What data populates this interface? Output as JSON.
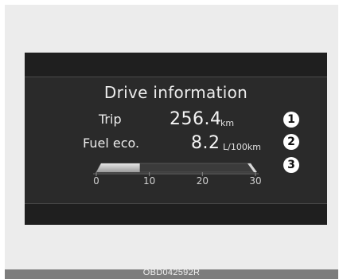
{
  "screen": {
    "title": "Drive information",
    "trip": {
      "label": "Trip",
      "value": "256.4",
      "unit": "km",
      "marker": "1"
    },
    "fuel_economy": {
      "label": "Fuel eco.",
      "value": "8.2",
      "unit": "L/100km",
      "marker": "2"
    },
    "gauge": {
      "marker": "3",
      "scale": {
        "min": 0,
        "max": 30
      },
      "ticks": [
        "0",
        "10",
        "20",
        "30"
      ],
      "current_value": 8.2
    }
  },
  "caption": "OBD042592R",
  "colors": {
    "display_background": "#2a2a2a",
    "band": "#1f1f1f",
    "text": "#ececec",
    "gauge_fill": "#c9c9c9",
    "gauge_track": "#3a3a3a"
  }
}
